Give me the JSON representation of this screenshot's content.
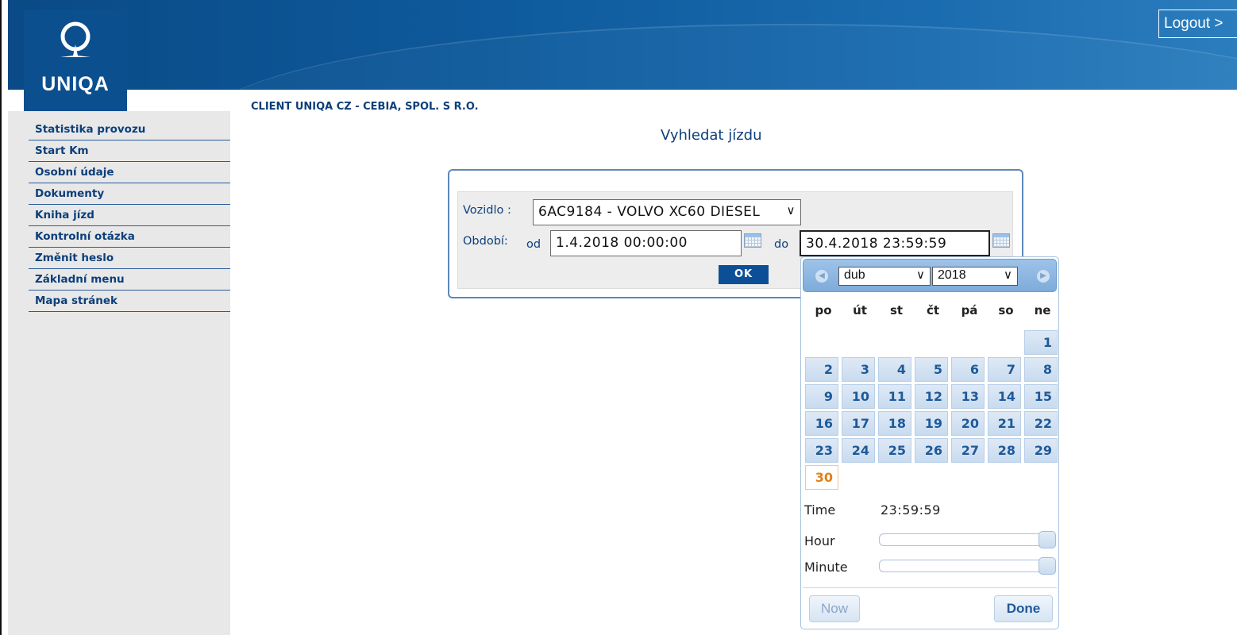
{
  "header": {
    "logo_text": "UNIQA",
    "logout_label": "Logout >"
  },
  "sidebar": {
    "items": [
      {
        "label": "Statistika provozu"
      },
      {
        "label": "Start Km"
      },
      {
        "label": "Osobní údaje"
      },
      {
        "label": "Dokumenty"
      },
      {
        "label": "Kniha jízd"
      },
      {
        "label": "Kontrolní otázka"
      },
      {
        "label": "Změnit heslo"
      },
      {
        "label": "Základní menu"
      },
      {
        "label": "Mapa stránek"
      }
    ]
  },
  "main": {
    "client": "CLIENT UNIQA CZ - CEBIA, SPOL. S R.O.",
    "title": "Vyhledat jízdu",
    "form": {
      "vehicle_label": "Vozidlo :",
      "vehicle_value": "6AC9184 - VOLVO XC60 DIESEL",
      "period_label": "Období:",
      "from_label": "od",
      "from_value": "1.4.2018 00:00:00",
      "to_label": "do",
      "to_value": "30.4.2018 23:59:59",
      "ok_label": "OK"
    }
  },
  "datepicker": {
    "month": "dub",
    "year": "2018",
    "weekdays": [
      "po",
      "út",
      "st",
      "čt",
      "pá",
      "so",
      "ne"
    ],
    "days": [
      "1",
      "2",
      "3",
      "4",
      "5",
      "6",
      "7",
      "8",
      "9",
      "10",
      "11",
      "12",
      "13",
      "14",
      "15",
      "16",
      "17",
      "18",
      "19",
      "20",
      "21",
      "22",
      "23",
      "24",
      "25",
      "26",
      "27",
      "28",
      "29",
      "30"
    ],
    "first_weekday_index": 6,
    "selected_day": "30",
    "time_label": "Time",
    "time_value": "23:59:59",
    "hour_label": "Hour",
    "minute_label": "Minute",
    "hour_level": 1.0,
    "minute_level": 1.0,
    "now_label": "Now",
    "done_label": "Done"
  },
  "colors": {
    "brand": "#0b4f8f",
    "link": "#0d3f7a",
    "today": "#e0801a"
  }
}
